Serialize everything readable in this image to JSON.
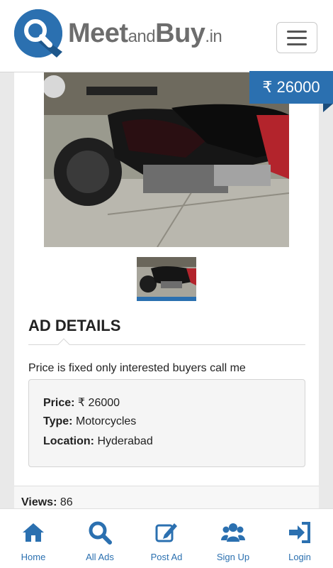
{
  "header": {
    "logo_main": "Meet",
    "logo_and": "and",
    "logo_buy": "Buy",
    "logo_tld": ".in"
  },
  "listing": {
    "price_tag": "₹ 26000",
    "section_title": "AD DETAILS",
    "description": "Price is fixed only interested buyers call me",
    "price_label": "Price:",
    "price_value": "₹ 26000",
    "type_label": "Type:",
    "type_value": "Motorcycles",
    "location_label": "Location:",
    "location_value": "Hyderabad",
    "views_label": "Views:",
    "views_value": "86"
  },
  "nav": {
    "items": [
      {
        "label": "Home",
        "icon": "home-icon"
      },
      {
        "label": "All Ads",
        "icon": "search-icon"
      },
      {
        "label": "Post Ad",
        "icon": "edit-icon"
      },
      {
        "label": "Sign Up",
        "icon": "users-icon"
      },
      {
        "label": "Login",
        "icon": "login-icon"
      }
    ]
  },
  "colors": {
    "brand": "#2b70b0",
    "text": "#222222"
  }
}
